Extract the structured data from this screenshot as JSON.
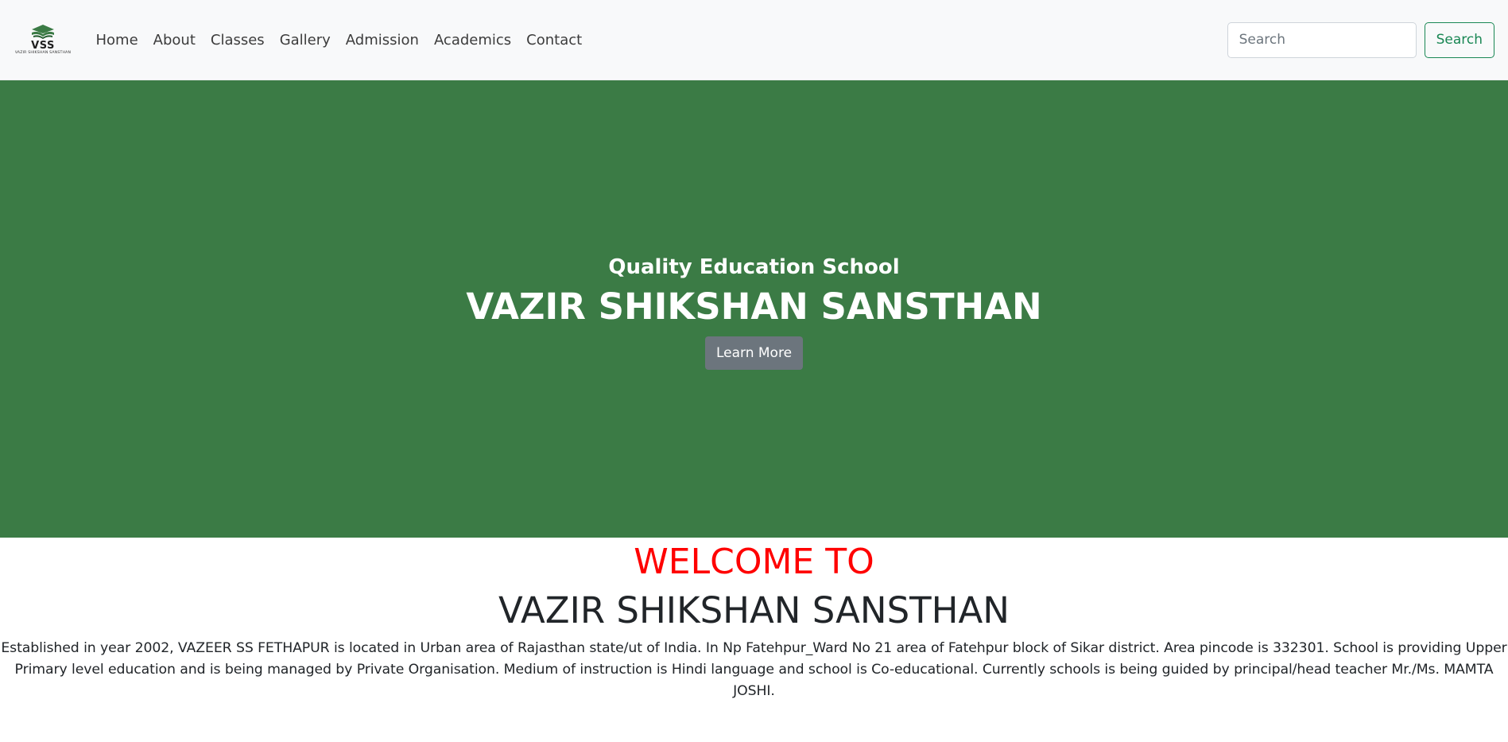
{
  "brand": {
    "abbr": "VSS",
    "full_name": "VAZIR SHIKSHAN SANSTHAN",
    "icon": "book-stack-logo-icon"
  },
  "nav": {
    "items": [
      {
        "label": "Home"
      },
      {
        "label": "About"
      },
      {
        "label": "Classes"
      },
      {
        "label": "Gallery"
      },
      {
        "label": "Admission"
      },
      {
        "label": "Academics"
      },
      {
        "label": "Contact"
      }
    ],
    "search_placeholder": "Search",
    "search_button": "Search"
  },
  "hero": {
    "subtitle": "Quality Education School",
    "title": "VAZIR SHIKSHAN SANSTHAN",
    "button": "Learn More",
    "background_color": "#3b7b45"
  },
  "welcome": {
    "heading": "WELCOME TO",
    "name": "VAZIR SHIKSHAN SANSTHAN",
    "description": "Established in year 2002, VAZEER SS FETHAPUR is located in Urban area of Rajasthan state/ut of India. In Np Fatehpur_Ward No 21 area of Fatehpur block of Sikar district. Area pincode is 332301. School is providing Upper Primary level education and is being managed by Private Organisation. Medium of instruction is Hindi language and school is Co-educational. Currently schools is being guided by principal/head teacher Mr./Ms. MAMTA JOSHI.",
    "heading_color": "#ff0000"
  }
}
